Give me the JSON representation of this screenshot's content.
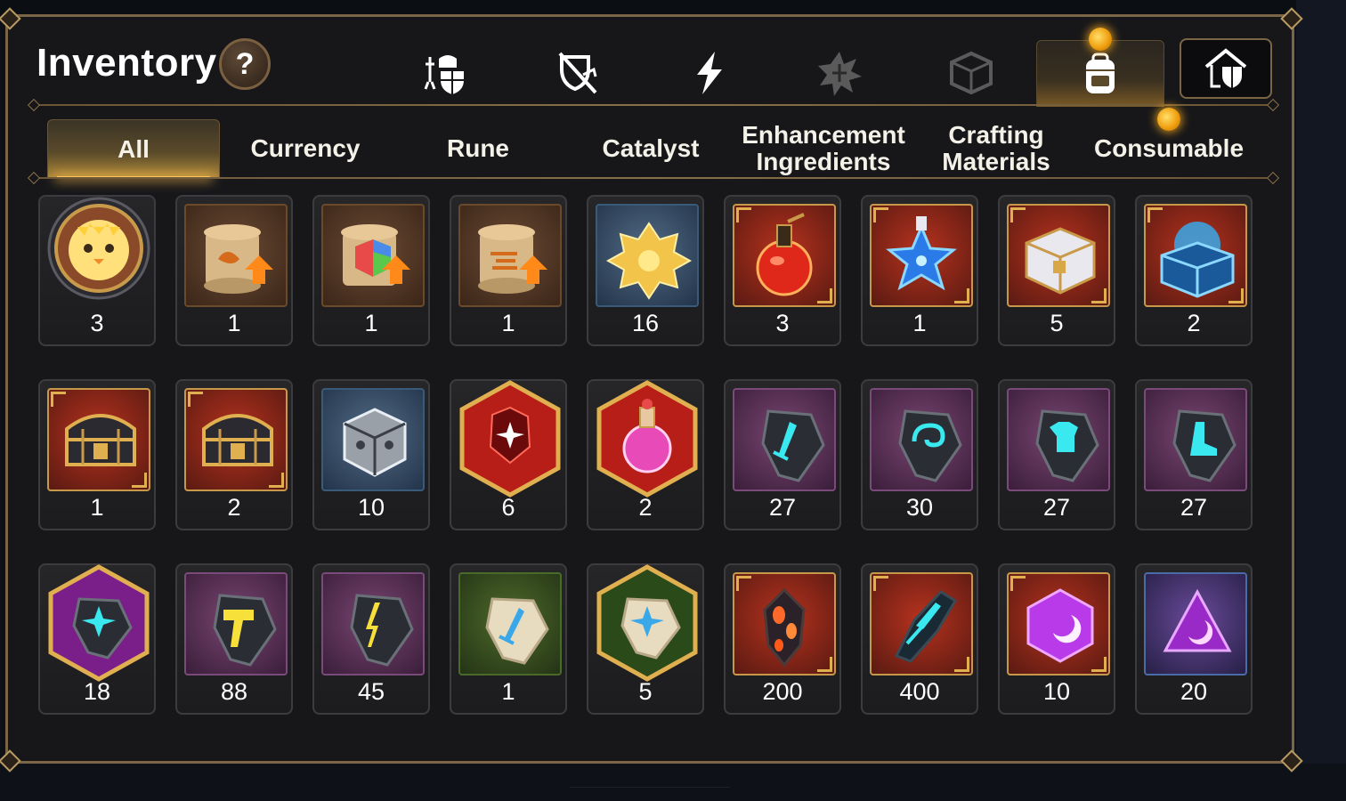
{
  "header": {
    "title": "Inventory",
    "help_label": "?"
  },
  "category_tabs": [
    {
      "icon": "knight-shield-icon",
      "active": false
    },
    {
      "icon": "broken-shield-icon",
      "active": false
    },
    {
      "icon": "lightning-icon",
      "active": false
    },
    {
      "icon": "spiked-star-icon",
      "active": false
    },
    {
      "icon": "dice-icon",
      "active": false
    },
    {
      "icon": "backpack-icon",
      "active": true,
      "notification": true
    },
    {
      "icon": "house-shield-icon",
      "active": false
    }
  ],
  "sub_tabs": [
    {
      "label": "All",
      "active": true
    },
    {
      "label": "Currency"
    },
    {
      "label": "Rune"
    },
    {
      "label": "Catalyst"
    },
    {
      "label": "Enhancement",
      "label2": "Ingredients"
    },
    {
      "label": "Crafting",
      "label2": "Materials"
    },
    {
      "label": "Consumable",
      "notification": true
    }
  ],
  "items": [
    {
      "icon": "chick-portrait-icon",
      "count": "3"
    },
    {
      "icon": "scroll-upgrade-icon",
      "count": "1"
    },
    {
      "icon": "rainbow-scroll-upgrade-icon",
      "count": "1"
    },
    {
      "icon": "scroll-upgrade-icon",
      "count": "1"
    },
    {
      "icon": "gold-crystal-flower-icon",
      "count": "16"
    },
    {
      "icon": "red-potion-icon",
      "count": "3"
    },
    {
      "icon": "blue-star-potion-icon",
      "count": "1"
    },
    {
      "icon": "white-gold-chest-icon",
      "count": "5"
    },
    {
      "icon": "blue-crystal-chest-icon",
      "count": "2"
    },
    {
      "icon": "gold-chest-icon",
      "count": "1"
    },
    {
      "icon": "gold-chest-icon",
      "count": "2"
    },
    {
      "icon": "silver-cube-icon",
      "count": "10"
    },
    {
      "icon": "red-star-gem-icon",
      "count": "6"
    },
    {
      "icon": "pink-potion-icon",
      "count": "2"
    },
    {
      "icon": "sword-rune-icon",
      "count": "27"
    },
    {
      "icon": "spiral-rune-icon",
      "count": "30"
    },
    {
      "icon": "armor-rune-icon",
      "count": "27"
    },
    {
      "icon": "boot-rune-icon",
      "count": "27"
    },
    {
      "icon": "star-rune-icon",
      "count": "18"
    },
    {
      "icon": "hammer-rune-icon",
      "count": "88"
    },
    {
      "icon": "bolt-rune-icon",
      "count": "45"
    },
    {
      "icon": "stone-sword-rune-icon",
      "count": "1"
    },
    {
      "icon": "stone-star-rune-icon",
      "count": "5"
    },
    {
      "icon": "dark-shard-icon",
      "count": "200"
    },
    {
      "icon": "cyan-shard-icon",
      "count": "400"
    },
    {
      "icon": "moon-gem-icon",
      "count": "10"
    },
    {
      "icon": "moon-crystal-icon",
      "count": "20"
    }
  ],
  "colors": {
    "accent_gold": "#ffc75a",
    "frame": "#7a6646",
    "notification": "#f0a010"
  }
}
